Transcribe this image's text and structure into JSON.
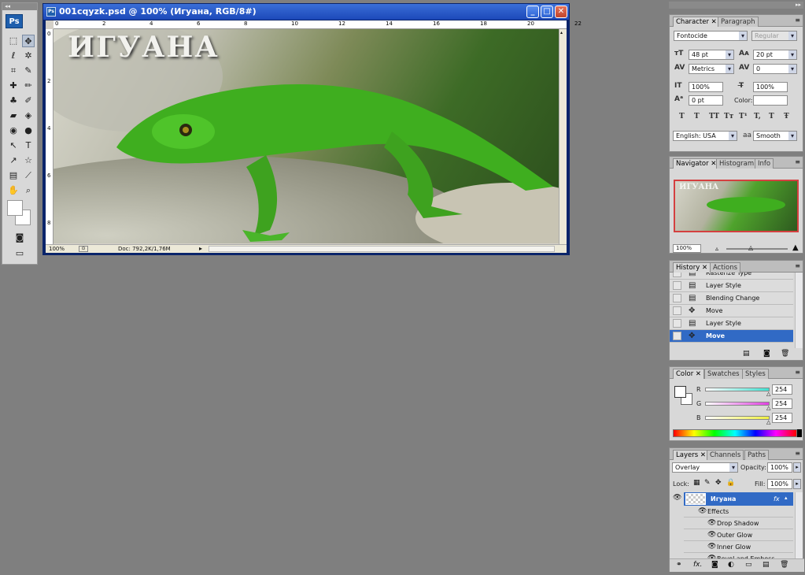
{
  "toolbox": {
    "logo": "Ps",
    "tools": [
      {
        "name": "marquee-tool",
        "glyph": "⬚"
      },
      {
        "name": "move-tool",
        "glyph": "✥"
      },
      {
        "name": "lasso-tool",
        "glyph": "ℓ"
      },
      {
        "name": "magic-wand-tool",
        "glyph": "✲"
      },
      {
        "name": "crop-tool",
        "glyph": "⌗"
      },
      {
        "name": "slice-tool",
        "glyph": "✎"
      },
      {
        "name": "healing-brush-tool",
        "glyph": "✚"
      },
      {
        "name": "brush-tool",
        "glyph": "✏"
      },
      {
        "name": "clone-stamp-tool",
        "glyph": "♣"
      },
      {
        "name": "history-brush-tool",
        "glyph": "✐"
      },
      {
        "name": "eraser-tool",
        "glyph": "▰"
      },
      {
        "name": "paint-bucket-tool",
        "glyph": "◈"
      },
      {
        "name": "blur-tool",
        "glyph": "◉"
      },
      {
        "name": "dodge-tool",
        "glyph": "●"
      },
      {
        "name": "path-selection-tool",
        "glyph": "↖"
      },
      {
        "name": "type-tool",
        "glyph": "T"
      },
      {
        "name": "direct-selection-tool",
        "glyph": "↗"
      },
      {
        "name": "shape-tool",
        "glyph": "☆"
      },
      {
        "name": "notes-tool",
        "glyph": "▤"
      },
      {
        "name": "eyedropper-tool",
        "glyph": "⟋"
      },
      {
        "name": "hand-tool",
        "glyph": "✋"
      },
      {
        "name": "zoom-tool",
        "glyph": "⌕"
      }
    ]
  },
  "document": {
    "title": "001cqyzk.psd @ 100% (Игуана, RGB/8#)",
    "canvas_text": "ИГУАНА",
    "ruler_h_marks": [
      "0",
      "2",
      "4",
      "6",
      "8",
      "10",
      "12",
      "14",
      "16",
      "18",
      "20",
      "22"
    ],
    "ruler_v_marks": [
      "0",
      "2",
      "4",
      "6",
      "8"
    ],
    "zoom": "100%",
    "doc_info": "Doc: 792,2K/1,76M",
    "controls": {
      "minimize": "_",
      "maximize": "□",
      "close": "✕"
    }
  },
  "character_panel": {
    "tabs": [
      "Character",
      "Paragraph"
    ],
    "font_family": "Fontocide",
    "font_style": "Regular",
    "font_size": "48 pt",
    "leading": "20 pt",
    "kerning": "Metrics",
    "tracking": "0",
    "vertical_scale": "100%",
    "horizontal_scale": "100%",
    "baseline_shift": "0 pt",
    "color_label": "Color:",
    "style_buttons": [
      "T",
      "T",
      "TT",
      "Tт",
      "T¹",
      "T,",
      "T",
      "Ŧ"
    ],
    "language": "English: USA",
    "antialias_prefix": "aa",
    "antialias": "Smooth"
  },
  "navigator_panel": {
    "tabs": [
      "Navigator",
      "Histogram",
      "Info"
    ],
    "zoom": "100%"
  },
  "history_panel": {
    "tabs": [
      "History",
      "Actions"
    ],
    "items": [
      {
        "label": "Rasterize Type",
        "icon": "▤"
      },
      {
        "label": "Layer Style",
        "icon": "▤"
      },
      {
        "label": "Blending Change",
        "icon": "▤"
      },
      {
        "label": "Move",
        "icon": "✥"
      },
      {
        "label": "Layer Style",
        "icon": "▤"
      },
      {
        "label": "Move",
        "icon": "✥"
      }
    ],
    "selected_index": 5
  },
  "color_panel": {
    "tabs": [
      "Color",
      "Swatches",
      "Styles"
    ],
    "channels": [
      {
        "label": "R",
        "value": "254",
        "color": "#40e0d0"
      },
      {
        "label": "G",
        "value": "254",
        "color": "#e040e0"
      },
      {
        "label": "B",
        "value": "254",
        "color": "#f0f040"
      }
    ]
  },
  "layers_panel": {
    "tabs": [
      "Layers",
      "Channels",
      "Paths"
    ],
    "blend_mode": "Overlay",
    "opacity_label": "Opacity:",
    "opacity": "100%",
    "lock_label": "Lock:",
    "fill_label": "Fill:",
    "fill": "100%",
    "layer_name": "Игуана",
    "fx_badge": "fx",
    "effects_label": "Effects",
    "effects": [
      "Drop Shadow",
      "Outer Glow",
      "Inner Glow",
      "Bevel and Emboss"
    ]
  },
  "colors": {
    "selection": "#316ac5",
    "titlebar": "#1c48b8"
  }
}
